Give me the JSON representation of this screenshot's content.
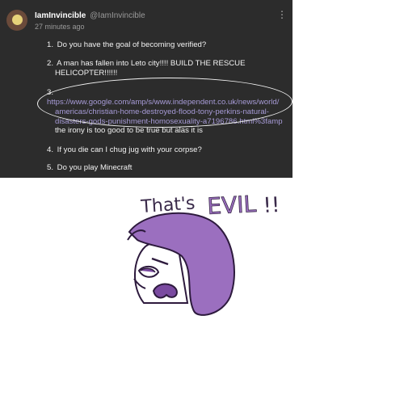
{
  "post": {
    "username": "IamInvincible",
    "handle": "@IamInvincible",
    "time": "27 minutes ago",
    "items": [
      {
        "num": "1.",
        "text": "Do you have the goal of becoming verified?"
      },
      {
        "num": "2.",
        "text": "A man has fallen into Leto city!!!! BUILD THE RESCUE",
        "text2": "HELICOPTER!!!!!!"
      },
      {
        "num": "3.",
        "link1": "https://www.google.com/amp/s/www.independent.co.uk/news/world/",
        "link2": "americas/christian-home-destroyed-flood-tony-perkins-natural-",
        "link3": "disasters-gods-punishment-homosexuality-a7196786.html%3famp",
        "text": "the irony is too good to be true but alas it is"
      },
      {
        "num": "4.",
        "text": "If you die can I chug jug with your corpse?"
      },
      {
        "num": "5.",
        "text": "Do you play Minecraft"
      }
    ]
  },
  "drawing": {
    "caption_plain": "That's",
    "caption_emph": "EVIL",
    "caption_tail": "!!",
    "ink_color": "#9b6fbf",
    "face_color": "#ffffff",
    "stroke_color": "#2d1a3d"
  }
}
